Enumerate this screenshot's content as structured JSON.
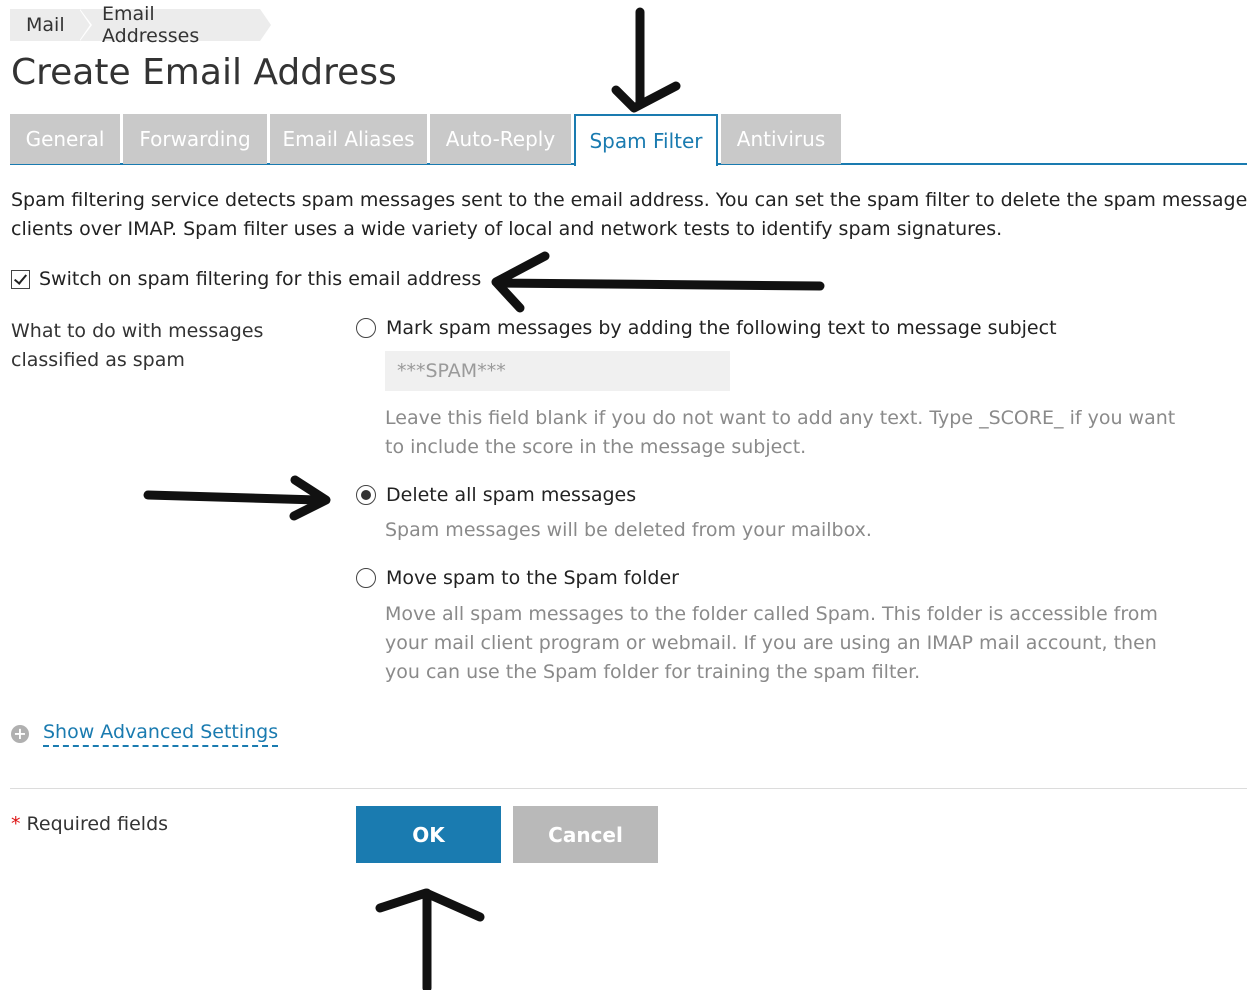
{
  "breadcrumb": [
    "Mail",
    "Email Addresses"
  ],
  "page_title": "Create Email Address",
  "tabs": [
    {
      "label": "General"
    },
    {
      "label": "Forwarding"
    },
    {
      "label": "Email Aliases"
    },
    {
      "label": "Auto-Reply"
    },
    {
      "label": "Spam Filter",
      "active": true
    },
    {
      "label": "Antivirus"
    }
  ],
  "description": {
    "line1": "Spam filtering service detects spam messages sent to the email address. You can set the spam filter to delete the spam messages,",
    "line2": "clients over IMAP. Spam filter uses a wide variety of local and network tests to identify spam signatures."
  },
  "spam_switch": {
    "label": "Switch on spam filtering for this email address",
    "checked": true
  },
  "spam_action": {
    "label": "What to do with messages classified as spam",
    "options": [
      {
        "label": "Mark spam messages by adding the following text to message subject",
        "selected": false,
        "input_placeholder": "***SPAM***",
        "hint": "Leave this field blank if you do not want to add any text. Type _SCORE_ if you want to include the score in the message subject."
      },
      {
        "label": "Delete all spam messages",
        "selected": true,
        "hint": "Spam messages will be deleted from your mailbox."
      },
      {
        "label": "Move spam to the Spam folder",
        "selected": false,
        "hint": "Move all spam messages to the folder called Spam. This folder is accessible from your mail client program or webmail. If you are using an IMAP mail account, then you can use the Spam folder for training the spam filter."
      }
    ]
  },
  "advanced_link": "Show Advanced Settings",
  "required_note": {
    "star": "*",
    "text": " Required fields"
  },
  "buttons": {
    "ok": "OK",
    "cancel": "Cancel"
  },
  "colors": {
    "accent": "#1a7bb0",
    "tab_inactive": "#c9c9c9",
    "cancel": "#b9b9b9",
    "required": "#dd1111"
  }
}
